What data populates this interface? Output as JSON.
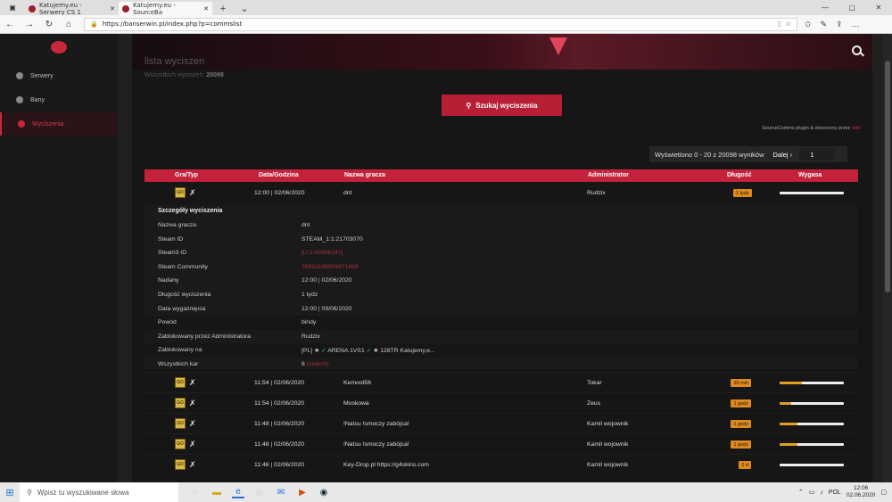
{
  "browser": {
    "tabs": [
      {
        "title": "Katujemy.eu - Serwery CS 1",
        "active": false
      },
      {
        "title": "Katujemy.eu - SourceBa",
        "active": true
      }
    ],
    "url": "https://banserwin.pl/index.php?p=commslist"
  },
  "sidebar": {
    "items": [
      {
        "label": "Serwery",
        "active": false
      },
      {
        "label": "Bany",
        "active": false
      },
      {
        "label": "Wyciszenia",
        "active": true
      }
    ]
  },
  "header": {
    "title": "lista wyciszen",
    "subtitle_prefix": "Wszystkich wyciszeń:",
    "subtitle_count": "20098"
  },
  "search_button": {
    "label": "Szukaj wyciszenia"
  },
  "credit": {
    "text": "SourceComms plugin & stworzony przez",
    "author": "ddd"
  },
  "pager": {
    "text": "Wyświetlono 0 - 20 z 20098 wyników",
    "next": "Dalej ›",
    "page": "1"
  },
  "table": {
    "headers": [
      "Gra/Typ",
      "Data/Godzina",
      "Nazwa gracza",
      "Administrator",
      "Długość",
      "Wygasa"
    ],
    "first_row": {
      "date": "12:00 | 02/06/2020",
      "player": "dnt",
      "admin": "Rudzix",
      "length": "1 tydz",
      "progress": 0.0
    },
    "details": {
      "title": "Szczegóły wyciszenia",
      "rows": [
        {
          "k": "Nazwa gracza",
          "v": "dnt"
        },
        {
          "k": "Steam ID",
          "v": "STEAM_1:1:21703070"
        },
        {
          "k": "Steam3 ID",
          "v": "[U:1:43406141]"
        },
        {
          "k": "Steam Community",
          "v": "76561198003671869"
        },
        {
          "k": "Nadany",
          "v": "12:00 | 02/06/2020"
        },
        {
          "k": "Długość wyciszenia",
          "v": "1 tydz"
        },
        {
          "k": "Data wygaśnięcia",
          "v": "12:00 | 09/06/2020"
        },
        {
          "k": "Powód",
          "v": "bindy"
        },
        {
          "k": "Zablokowany przez Administratora",
          "v": "Rudzix"
        },
        {
          "k": "Zablokowany na",
          "v_a": "[PL] ★",
          "v_b": "ARENA 1VS1",
          "v_c": "★ 128TR Katujemy.e..."
        },
        {
          "k": "Wszystkich kar",
          "v": "8",
          "link": "(search)"
        }
      ]
    },
    "rows": [
      {
        "date": "11:54 | 02/06/2020",
        "player": "Kemoot56",
        "admin": "Tokar",
        "length": "30 min",
        "progress": 0.35
      },
      {
        "date": "11:54 | 02/06/2020",
        "player": "Moskowa",
        "admin": "Zeus",
        "length": "1 godz",
        "progress": 0.18
      },
      {
        "date": "11:48 | 02/06/2020",
        "player": "!Natsu !smoczy zabójca!",
        "admin": "Kamil wojownik",
        "length": "1 godz",
        "progress": 0.28
      },
      {
        "date": "11:48 | 02/06/2020",
        "player": "!Natsu !smoczy zabójca!",
        "admin": "Kamil wojownik",
        "length": "1 godz",
        "progress": 0.28
      },
      {
        "date": "11:46 | 02/06/2020",
        "player": "Key-Drop.pl https://g4skins.com",
        "admin": "Kamil wojownik",
        "length": "2 d",
        "progress": 0.0
      }
    ]
  },
  "taskbar": {
    "search_placeholder": "Wpisz tu wyszukiwane słowa",
    "lang": "POL",
    "time": "12:06",
    "date": "02.06.2020"
  }
}
